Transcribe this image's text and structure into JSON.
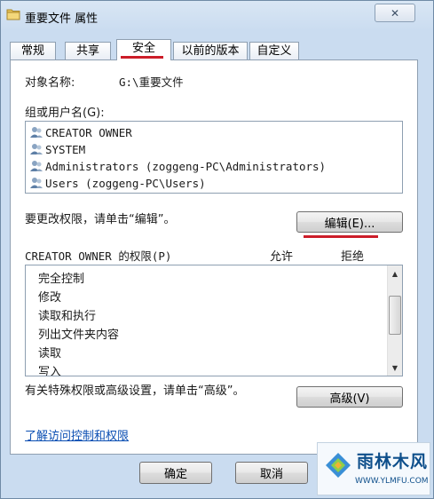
{
  "window": {
    "title": "重要文件 属性",
    "close_symbol": "✕"
  },
  "tabs": [
    {
      "label": "常规",
      "active": false
    },
    {
      "label": "共享",
      "active": false
    },
    {
      "label": "安全",
      "active": true
    },
    {
      "label": "以前的版本",
      "active": false
    },
    {
      "label": "自定义",
      "active": false
    }
  ],
  "security": {
    "object_name_label": "对象名称:",
    "object_name_value": "G:\\重要文件",
    "groups_label": "组或用户名(G):",
    "users": [
      "CREATOR OWNER",
      "SYSTEM",
      "Administrators (zoggeng-PC\\Administrators)",
      "Users (zoggeng-PC\\Users)"
    ],
    "change_hint": "要更改权限，请单击“编辑”。",
    "edit_button": "编辑(E)...",
    "permissions_title": "CREATOR OWNER 的权限(P)",
    "allow_header": "允许",
    "deny_header": "拒绝",
    "permissions": [
      "完全控制",
      "修改",
      "读取和执行",
      "列出文件夹内容",
      "读取",
      "写入"
    ],
    "advanced_hint": "有关特殊权限或高级设置，请单击“高级”。",
    "advanced_button": "高级(V)",
    "learn_link": "了解访问控制和权限"
  },
  "footer": {
    "ok_button": "确定",
    "cancel_button": "取消"
  },
  "watermark": {
    "text": "雨林木风",
    "url": "WWW.YLMFU.COM"
  },
  "colors": {
    "accent_underline": "#cc1d29",
    "link": "#0b4fb3"
  }
}
